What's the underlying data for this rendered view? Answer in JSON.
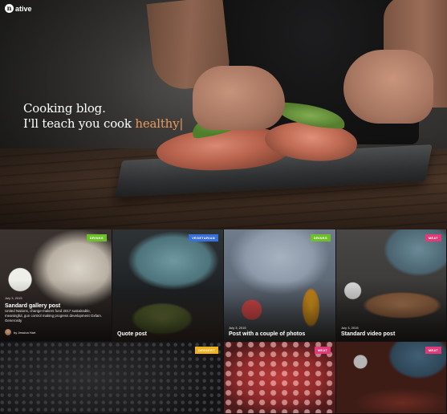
{
  "brand": {
    "logo_mark": "n",
    "name": "ative"
  },
  "hero": {
    "line1": "Cooking blog.",
    "line2_prefix": "I'll teach you cook",
    "line2_accent": "healthy",
    "cursor": "|",
    "accent_color": "#e89a5b"
  },
  "posts": [
    {
      "badge": "DRINKS",
      "badge_color": "#6fbf2a",
      "title": "Sandard gallery post",
      "date": "July 3, 2015",
      "excerpt": "United Nations, change-makers fund 2017 sustainable, meaningful, gun control making progress development Oxfam. Generosity",
      "author": "by Jessica Hart"
    },
    {
      "badge": "VEGETARIAN",
      "badge_color": "#3a6fd8",
      "title": "Quote post",
      "quote_icon": "“"
    },
    {
      "badge": "DRINKS",
      "badge_color": "#6fbf2a",
      "title": "Post with a couple of photos",
      "date": "July 3, 2015"
    },
    {
      "badge": "MEAT",
      "badge_color": "#e23a78",
      "title": "Standard video post",
      "date": "July 3, 2015"
    },
    {
      "badge": "DESSERT",
      "badge_color": "#f0b21d"
    },
    {
      "badge": "MEAT",
      "badge_color": "#e23a78"
    },
    {
      "badge": "MEAT",
      "badge_color": "#e23a78"
    },
    {
      "badge": "",
      "badge_color": ""
    }
  ]
}
